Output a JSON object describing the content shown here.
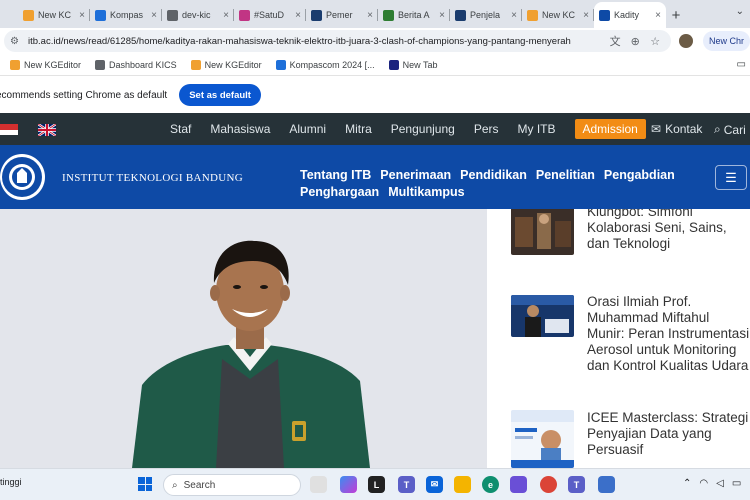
{
  "browser": {
    "tabs": [
      {
        "label": "New KC",
        "color": "#f0a030"
      },
      {
        "label": "Kompas",
        "color": "#1e6fd9"
      },
      {
        "label": "dev-kic",
        "color": "#5f6368"
      },
      {
        "label": "#SatuD",
        "color": "#c13584"
      },
      {
        "label": "Pemer",
        "color": "#1a3c6e"
      },
      {
        "label": "Berita A",
        "color": "#2e7d32"
      },
      {
        "label": "Penjela",
        "color": "#1a3c6e"
      },
      {
        "label": "New KC",
        "color": "#f0a030"
      },
      {
        "label": "Kadity",
        "color": "#0e4aa6"
      }
    ],
    "url": "itb.ac.id/news/read/61285/home/kaditya-rakan-mahasiswa-teknik-elektro-itb-juara-3-clash-of-champions-yang-pantang-menyerah",
    "new_chrome_label": "New Chr",
    "bookmarks": [
      {
        "label": "New KGEditor",
        "color": "#f0a030"
      },
      {
        "label": "Dashboard KICS",
        "color": "#5f6368"
      },
      {
        "label": "New KGEditor",
        "color": "#f0a030"
      },
      {
        "label": "Kompascom 2024 [...",
        "color": "#1e6fd9"
      },
      {
        "label": "New Tab",
        "color": "#1a237e"
      }
    ],
    "infobar_message": "ecommends setting Chrome as default",
    "infobar_button": "Set as default"
  },
  "site": {
    "top_nav": [
      "Staf",
      "Mahasiswa",
      "Alumni",
      "Mitra",
      "Pengunjung",
      "Pers",
      "My ITB"
    ],
    "admission_label": "Admission",
    "kontak_label": "Kontak",
    "cari_label": "Cari",
    "institution_name": "INSTITUT TEKNOLOGI BANDUNG",
    "main_nav": [
      "Tentang ITB",
      "Penerimaan",
      "Pendidikan",
      "Penelitian",
      "Pengabdian",
      "Penghargaan",
      "Multikampus"
    ]
  },
  "articles": [
    {
      "title": "Klungbot: Simfoni Kolaborasi Seni, Sains, dan Teknologi"
    },
    {
      "title": "Orasi Ilmiah Prof. Muhammad Miftahul Munir: Peran Instrumentasi Aerosol untuk Monitoring dan Kontrol Kualitas Udara"
    },
    {
      "title": "ICEE Masterclass: Strategi Penyajian Data yang Persuasif"
    }
  ],
  "taskbar": {
    "weather_label": "tinggi",
    "search_placeholder": "Search"
  }
}
